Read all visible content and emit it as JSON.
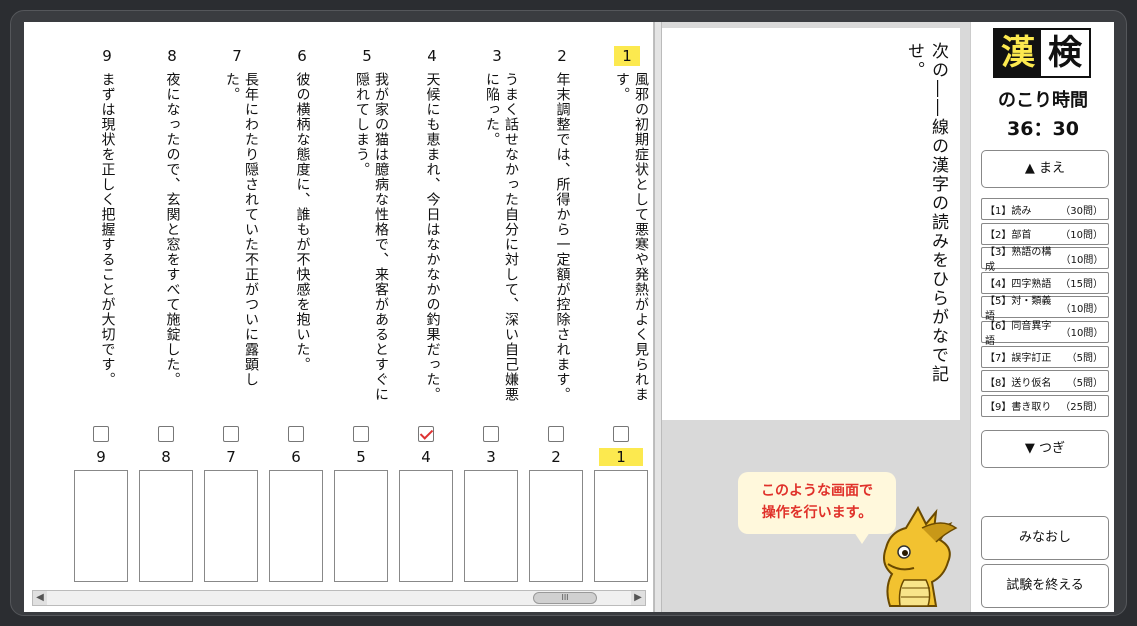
{
  "questions": [
    {
      "num": "1",
      "text": "風邪の初期症状として悪寒や発熱がよく見られます。",
      "active": true
    },
    {
      "num": "2",
      "text": "年末調整では、所得から一定額が控除されます。"
    },
    {
      "num": "3",
      "text": "うまく話せなかった自分に対して、深い自己嫌悪に陥った。"
    },
    {
      "num": "4",
      "text": "天候にも恵まれ、今日はなかなかの釣果だった。"
    },
    {
      "num": "5",
      "text": "我が家の猫は臆病な性格で、来客があるとすぐに隠れてしまう。"
    },
    {
      "num": "6",
      "text": "彼の横柄な態度に、誰もが不快感を抱いた。"
    },
    {
      "num": "7",
      "text": "長年にわたり隠されていた不正がついに露顕した。"
    },
    {
      "num": "8",
      "text": "夜になったので、玄関と窓をすべて施錠した。"
    },
    {
      "num": "9",
      "text": "まずは現状を正しく把握することが大切です。"
    }
  ],
  "answers": [
    {
      "num": "1",
      "checked": false,
      "active": true
    },
    {
      "num": "2",
      "checked": false
    },
    {
      "num": "3",
      "checked": false
    },
    {
      "num": "4",
      "checked": true
    },
    {
      "num": "5",
      "checked": false
    },
    {
      "num": "6",
      "checked": false
    },
    {
      "num": "7",
      "checked": false
    },
    {
      "num": "8",
      "checked": false
    },
    {
      "num": "9",
      "checked": false
    }
  ],
  "instruction": "次の――線の漢字の読みをひらがなで記せ。",
  "bubble": {
    "line1": "このような画面で",
    "line2": "操作を行います。"
  },
  "logo": {
    "left": "漢",
    "right": "検"
  },
  "timer": {
    "label": "のこり時間",
    "value": "36：30"
  },
  "nav": {
    "prev": "▲ まえ",
    "next": "▼ つぎ",
    "review": "みなおし",
    "finish": "試験を終える"
  },
  "sections": [
    {
      "label": "【1】読み",
      "count": "（30問）"
    },
    {
      "label": "【2】部首",
      "count": "（10問）"
    },
    {
      "label": "【3】熟語の構成",
      "count": "（10問）"
    },
    {
      "label": "【4】四字熟語",
      "count": "（15問）"
    },
    {
      "label": "【5】対・類義語",
      "count": "（10問）"
    },
    {
      "label": "【6】同音異字語",
      "count": "（10問）"
    },
    {
      "label": "【7】誤字訂正",
      "count": "（5問）"
    },
    {
      "label": "【8】送り仮名",
      "count": "（5問）"
    },
    {
      "label": "【9】書き取り",
      "count": "（25問）"
    }
  ],
  "scrollbar": {
    "thumb_glyph": "III"
  }
}
